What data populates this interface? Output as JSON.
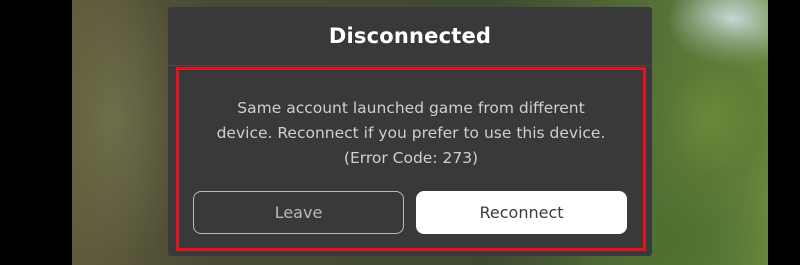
{
  "dialog": {
    "title": "Disconnected",
    "message_lines": [
      "Same account launched game from different",
      "device.  Reconnect if you prefer to use this device.",
      "(Error Code: 273)"
    ],
    "buttons": {
      "leave_label": "Leave",
      "reconnect_label": "Reconnect"
    }
  },
  "colors": {
    "dialog_background": "#39393b",
    "highlight_border": "#e3141b",
    "primary_button": "#ffffff",
    "secondary_button_border": "#b9b9b9"
  }
}
